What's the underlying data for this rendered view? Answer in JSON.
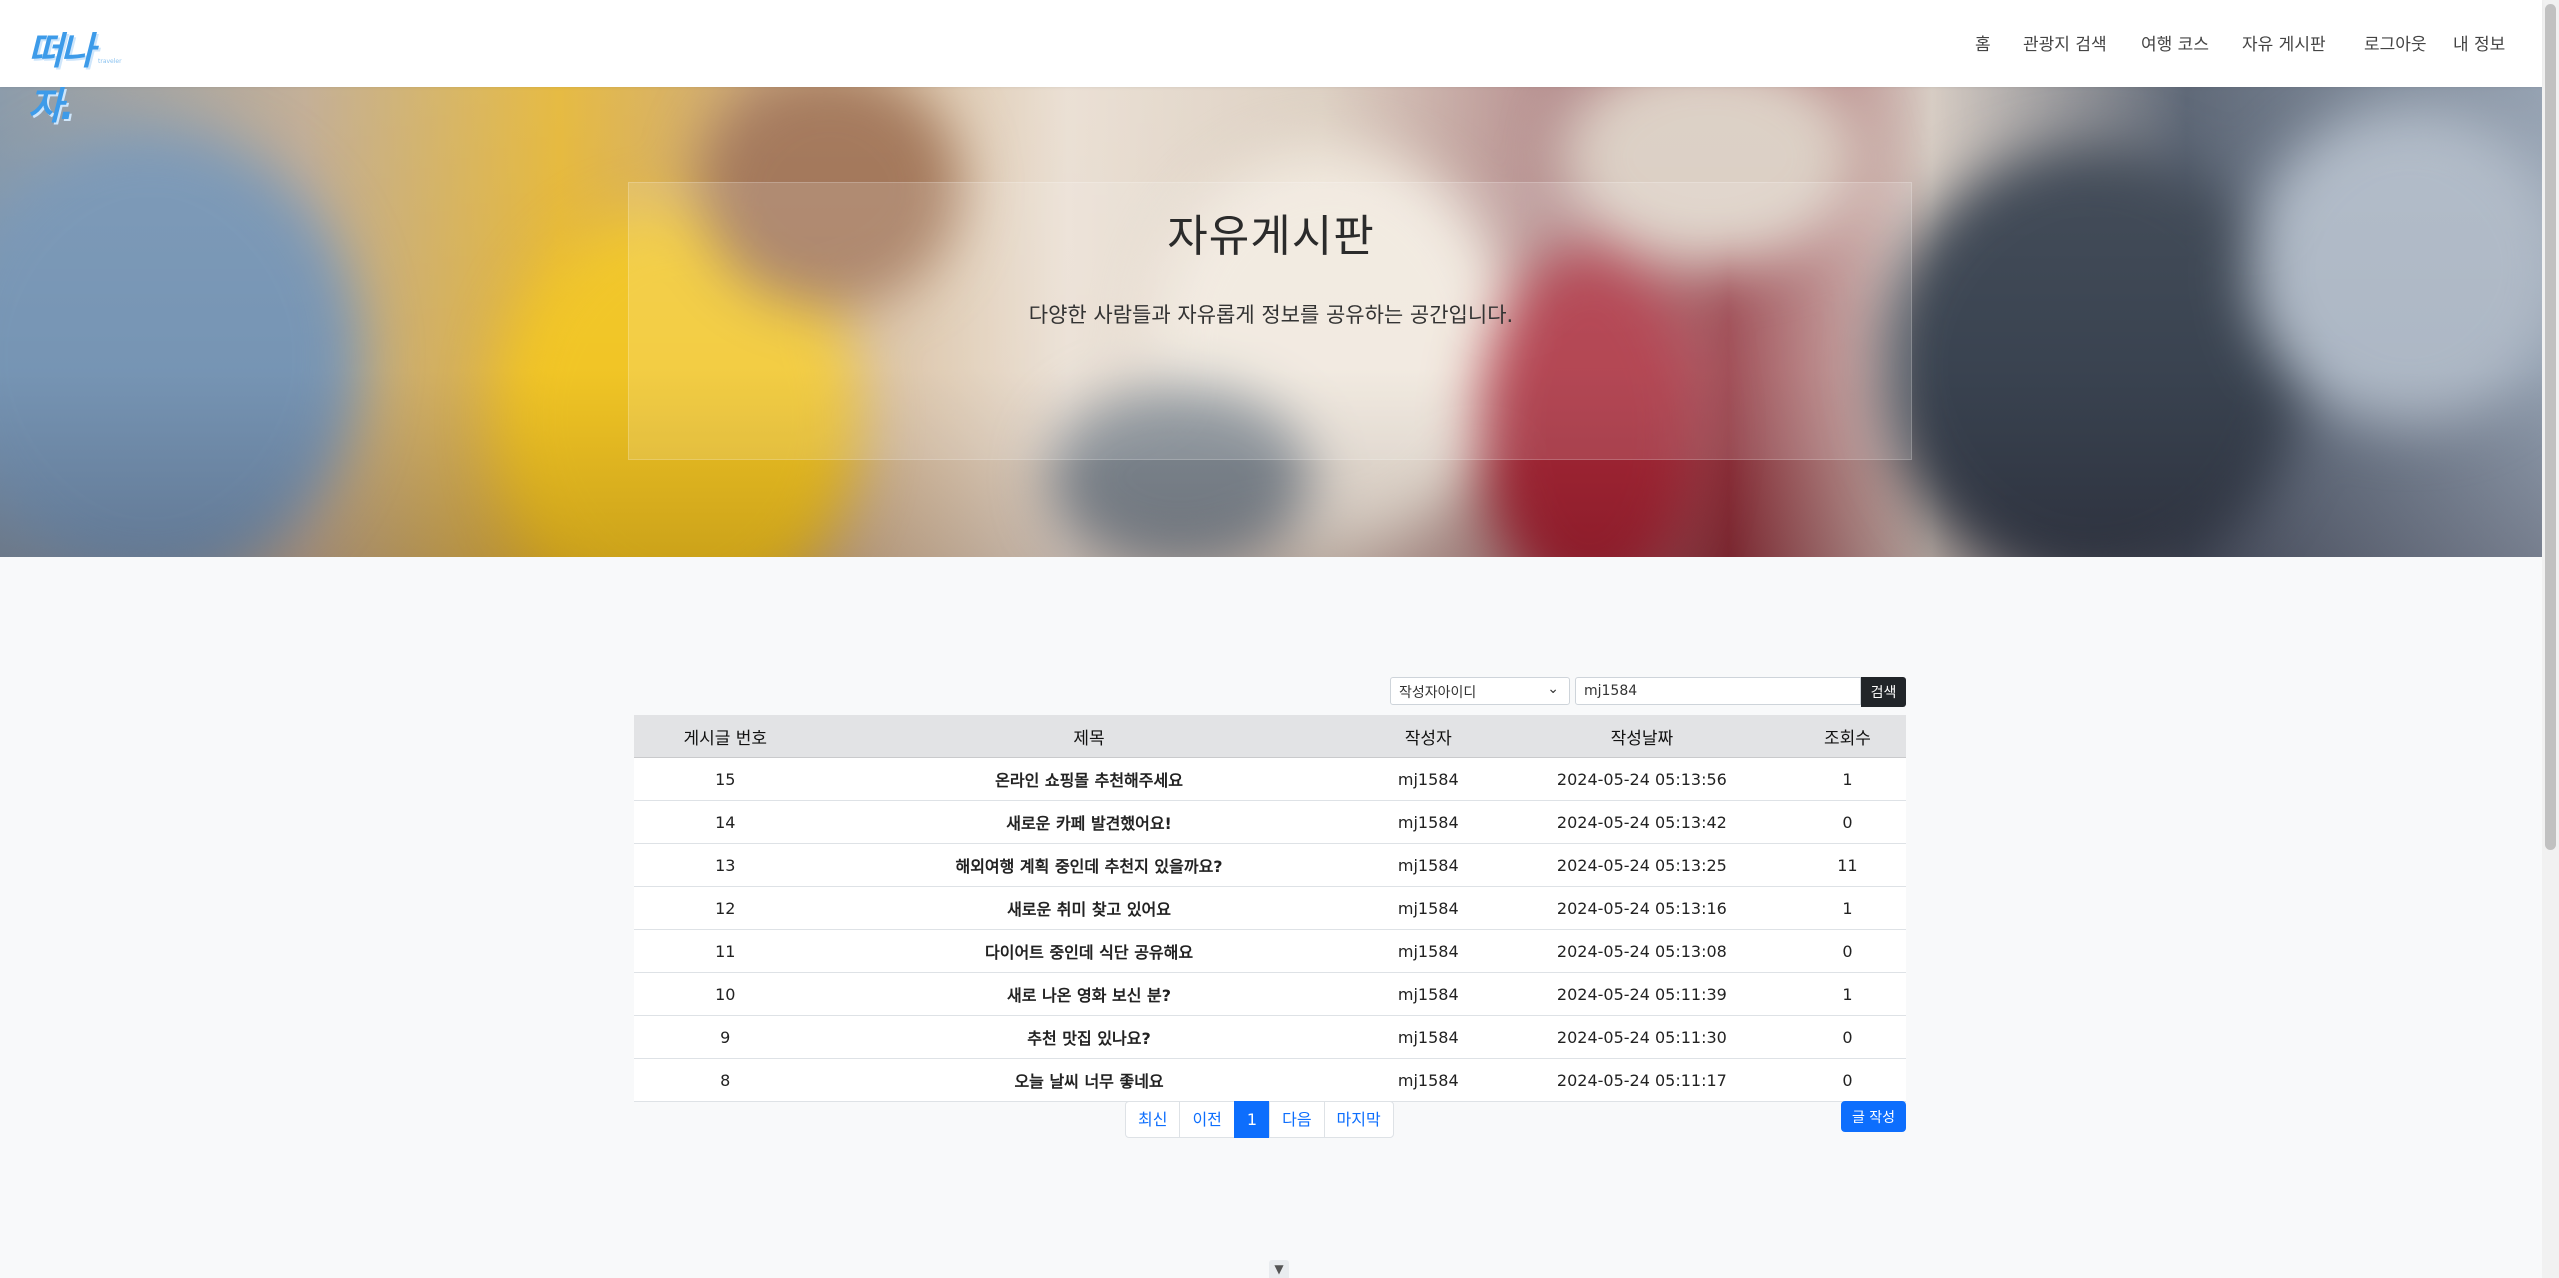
{
  "brand": {
    "logo_text": "떠나자.",
    "logo_sub": "traveler"
  },
  "nav": [
    {
      "label": "홈"
    },
    {
      "label": "관광지 검색"
    },
    {
      "label": "여행 코스"
    },
    {
      "label": "자유 게시판"
    },
    {
      "label": "로그아웃"
    },
    {
      "label": "내 정보"
    }
  ],
  "hero": {
    "title": "자유게시판",
    "subtitle": "다양한 사람들과 자유롭게 정보를 공유하는 공간입니다."
  },
  "search": {
    "field_selected": "작성자아이디",
    "query": "mj1584",
    "button_label": "검색"
  },
  "table": {
    "headers": [
      "게시글 번호",
      "제목",
      "작성자",
      "작성날짜",
      "조회수"
    ],
    "rows": [
      [
        "15",
        "온라인 쇼핑몰 추천해주세요",
        "mj1584",
        "2024-05-24 05:13:56",
        "1"
      ],
      [
        "14",
        "새로운 카페 발견했어요!",
        "mj1584",
        "2024-05-24 05:13:42",
        "0"
      ],
      [
        "13",
        "해외여행 계획 중인데 추천지 있을까요?",
        "mj1584",
        "2024-05-24 05:13:25",
        "11"
      ],
      [
        "12",
        "새로운 취미 찾고 있어요",
        "mj1584",
        "2024-05-24 05:13:16",
        "1"
      ],
      [
        "11",
        "다이어트 중인데 식단 공유해요",
        "mj1584",
        "2024-05-24 05:13:08",
        "0"
      ],
      [
        "10",
        "새로 나온 영화 보신 분?",
        "mj1584",
        "2024-05-24 05:11:39",
        "1"
      ],
      [
        "9",
        "추천 맛집 있나요?",
        "mj1584",
        "2024-05-24 05:11:30",
        "0"
      ],
      [
        "8",
        "오늘 날씨 너무 좋네요",
        "mj1584",
        "2024-05-24 05:11:17",
        "0"
      ]
    ]
  },
  "pagination": {
    "items": [
      "최신",
      "이전",
      "1",
      "다음",
      "마지막"
    ],
    "active": "1"
  },
  "write_button": "글 작성",
  "scroll_down_glyph": "▼",
  "colors": {
    "brand": "#3d9be9",
    "primary": "#0d6efd",
    "dark": "#212529"
  }
}
